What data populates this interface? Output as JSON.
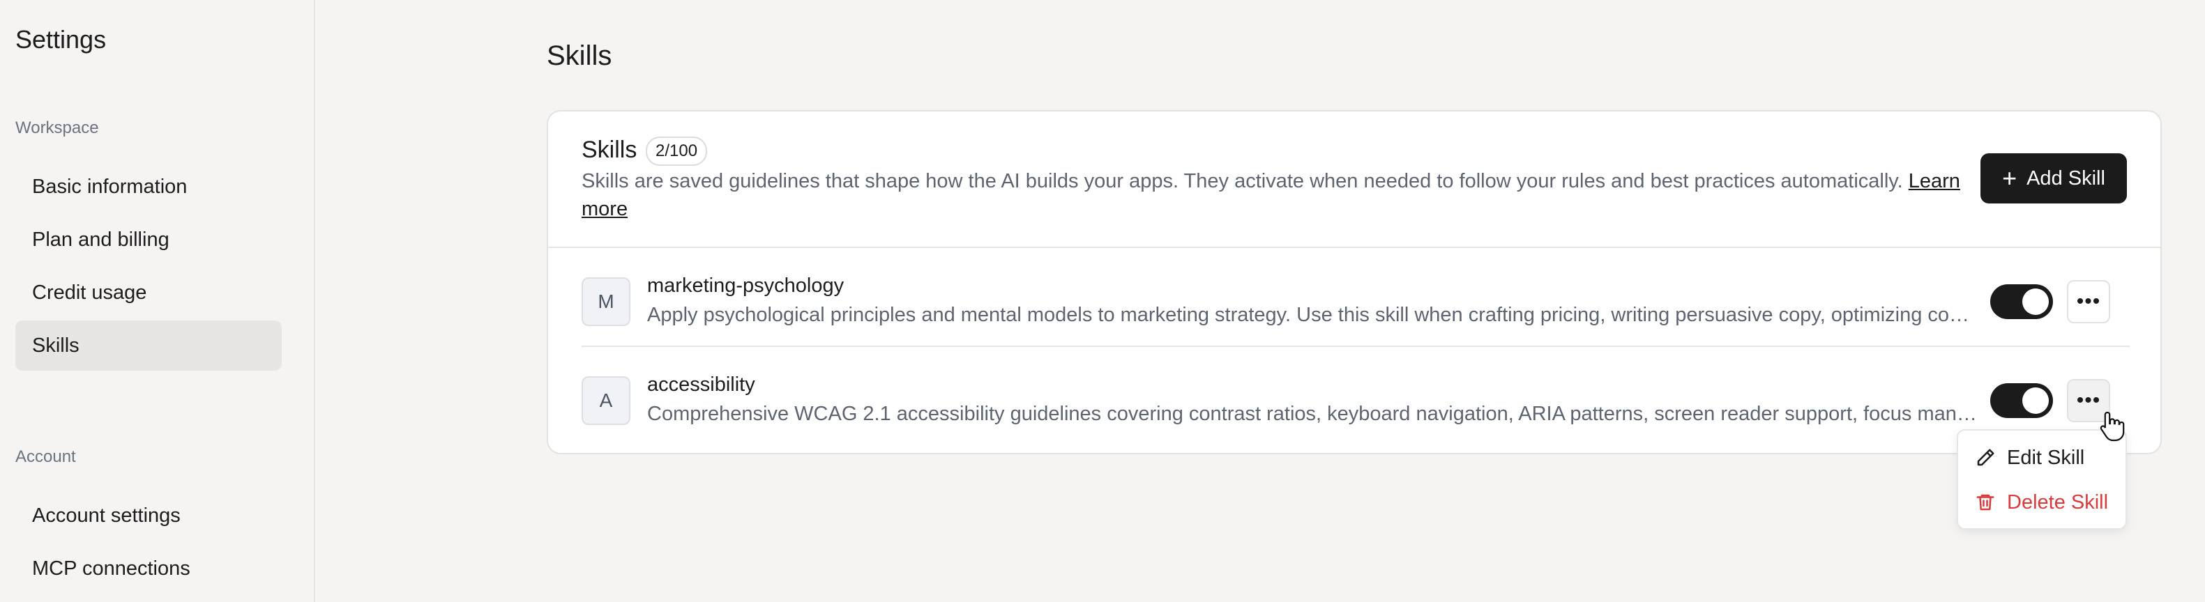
{
  "sidebar": {
    "title": "Settings",
    "workspace_label": "Workspace",
    "workspace_items": [
      {
        "label": "Basic information"
      },
      {
        "label": "Plan and billing"
      },
      {
        "label": "Credit usage"
      },
      {
        "label": "Skills",
        "active": true
      }
    ],
    "account_label": "Account",
    "account_items": [
      {
        "label": "Account settings"
      },
      {
        "label": "MCP connections"
      }
    ]
  },
  "main": {
    "page_title": "Skills",
    "card": {
      "heading": "Skills",
      "count": "2/100",
      "description": "Skills are saved guidelines that shape how the AI builds your apps. They activate when needed to follow your rules and best practices automatically.",
      "learn_more": "Learn more",
      "add_button": "Add Skill"
    },
    "skills": [
      {
        "initial": "M",
        "name": "marketing-psychology",
        "description": "Apply psychological principles and mental models to marketing strategy. Use this skill when crafting pricing, writing persuasive copy, optimizing conversion funnels, and designing campaigns.",
        "enabled": true,
        "more_icon": "more-horizontal-icon"
      },
      {
        "initial": "A",
        "name": "accessibility",
        "description": "Comprehensive WCAG 2.1 accessibility guidelines covering contrast ratios, keyboard navigation, ARIA patterns, screen reader support, focus management and more.",
        "enabled": true,
        "more_icon": "more-horizontal-icon"
      }
    ],
    "context_menu": {
      "items": [
        {
          "label": "Edit Skill",
          "icon": "pencil-icon"
        },
        {
          "label": "Delete Skill",
          "icon": "trash-icon",
          "color": "#d93b3b"
        }
      ]
    }
  },
  "colors": {
    "background": "#f5f4f2",
    "primary": "#1b1b1b",
    "danger": "#d93b3b",
    "muted_text": "#5d6470"
  }
}
